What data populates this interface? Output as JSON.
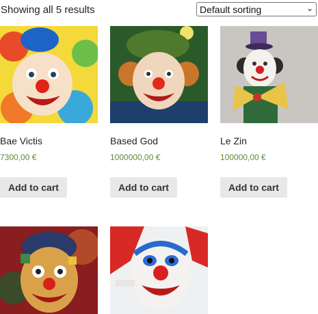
{
  "toolbar": {
    "result_count": "Showing all 5 results",
    "sort_selected": "Default sorting"
  },
  "products": [
    {
      "name": "Bae Victis",
      "price": "7300,00 €",
      "button": "Add to cart"
    },
    {
      "name": "Based God",
      "price": "1000000,00 €",
      "button": "Add to cart"
    },
    {
      "name": "Le Zin",
      "price": "100000,00 €",
      "button": "Add to cart"
    },
    {
      "name": "",
      "price": "",
      "button": ""
    },
    {
      "name": "",
      "price": "",
      "button": ""
    }
  ],
  "colors": {
    "price": "#5a8a3a",
    "button_bg": "#e8e8ea",
    "text": "#222222"
  },
  "icons": {
    "sort_chevron": "chevron-down-icon"
  }
}
